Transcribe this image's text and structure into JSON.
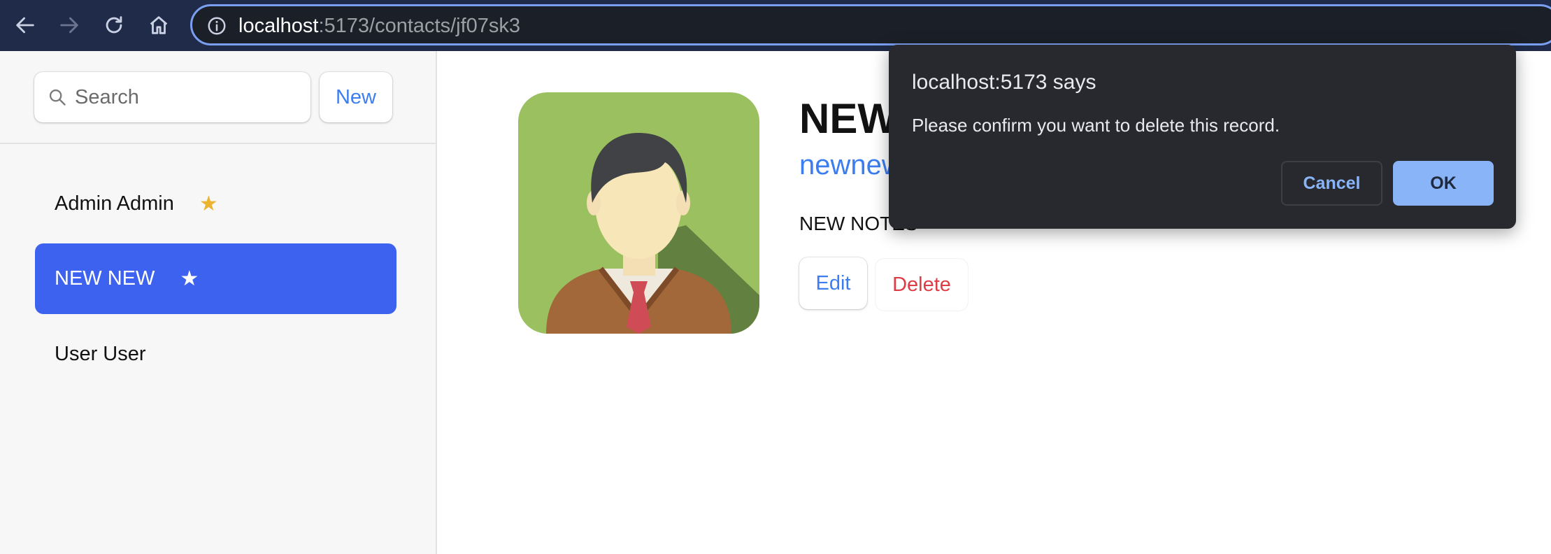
{
  "browser": {
    "url_host": "localhost",
    "url_rest": ":5173/contacts/jf07sk3",
    "icons": [
      "back-arrow-icon",
      "forward-arrow-icon",
      "reload-icon",
      "home-icon",
      "info-icon"
    ]
  },
  "sidebar": {
    "search": {
      "placeholder": "Search",
      "value": ""
    },
    "new_label": "New",
    "contacts": [
      {
        "name": "Admin Admin",
        "favorite": true,
        "active": false
      },
      {
        "name": "NEW NEW",
        "favorite": true,
        "active": true
      },
      {
        "name": "User User",
        "favorite": false,
        "active": false
      }
    ],
    "star_glyph": "★"
  },
  "main": {
    "contact_name": "NEW NEW",
    "twitter": "newnew",
    "notes": "NEW NOTES",
    "edit_label": "Edit",
    "delete_label": "Delete"
  },
  "dialog": {
    "title": "localhost:5173 says",
    "message": "Please confirm you want to delete this record.",
    "cancel_label": "Cancel",
    "ok_label": "OK"
  },
  "colors": {
    "toolbar_bg": "#1f2b48",
    "accent": "#3c7ef0",
    "active_item": "#3d62f0",
    "star_gold": "#eab330",
    "delete_red": "#de3d45",
    "dialog_bg": "#27292e",
    "dialog_button": "#8ab4f8"
  }
}
